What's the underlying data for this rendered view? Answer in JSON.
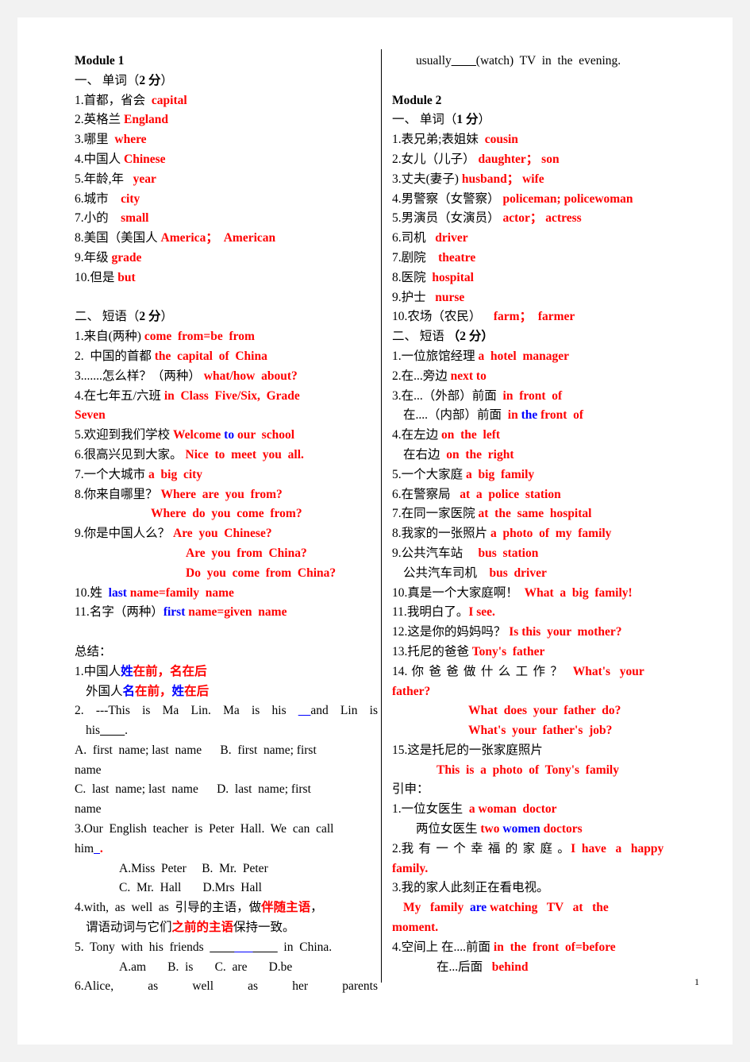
{
  "document": {
    "page_number": "1",
    "colors": {
      "answer_red": "#ff0000",
      "highlight_blue": "#0000ff",
      "body_black": "#000000",
      "page_background": "#ffffff",
      "canvas_background": "#f2f2f2"
    }
  },
  "left_column": {
    "module_title": "Module 1",
    "section_vocab_title_prefix": "一、 单词（",
    "section_vocab_points": "2 分",
    "section_vocab_title_suffix": "）",
    "vocab_items": [
      {
        "num": "1.",
        "cn": "首都，省会",
        "en": "capital"
      },
      {
        "num": "2.",
        "cn": "英格兰",
        "en": "England"
      },
      {
        "num": "3.",
        "cn": "哪里",
        "en": "where"
      },
      {
        "num": "4.",
        "cn": "中国人",
        "en": "Chinese"
      },
      {
        "num": "5.",
        "cn": "年龄,年",
        "en": "year"
      },
      {
        "num": "6.",
        "cn": "城市",
        "en": "city"
      },
      {
        "num": "7.",
        "cn": "小的",
        "en": "small"
      },
      {
        "num": "8.",
        "cn": "美国（美国人",
        "en": "America；  American"
      },
      {
        "num": "9.",
        "cn": "年级",
        "en": "grade"
      },
      {
        "num": "10.",
        "cn": "但是",
        "en": "but"
      }
    ],
    "section_phrase_title_prefix": "二、 短语（",
    "section_phrase_points": "2 分",
    "section_phrase_title_suffix": "）",
    "phrases": {
      "p1_num": "1.",
      "p1_cn": "来自(两种)",
      "p1_en": "come  from=be  from",
      "p2_num": "2.",
      "p2_cn": "  中国的首都",
      "p2_en": "the  capital  of  China",
      "p3_num": "3.",
      "p3_cn": "......怎么样？（两种）",
      "p3_en": "what/how  about?",
      "p4_num": "4.",
      "p4_cn": "在七年五/六班",
      "p4_en": "in  Class  Five/Six,  Grade",
      "p4_en_wrap": "Seven",
      "p5_num": "5.",
      "p5_cn": "欢迎到我们学校",
      "p5_en_a": "Welcome",
      "p5_en_blue": "to",
      "p5_en_b": "our  school",
      "p6_num": "6.",
      "p6_cn": "很高兴见到大家。",
      "p6_en": "Nice  to  meet  you  all.",
      "p7_num": "7.",
      "p7_cn": "一个大城市",
      "p7_en": "a  big  city",
      "p8_num": "8.",
      "p8_cn": "你来自哪里？",
      "p8_en_1": "Where  are  you  from?",
      "p8_en_2": "Where  do  you  come  from?",
      "p9_num": "9.",
      "p9_cn": "你是中国人么？",
      "p9_en_1": "Are  you  Chinese?",
      "p9_en_2": "Are  you  from  China?",
      "p9_en_3": "Do  you  come  from  China?",
      "p10_num": "10.",
      "p10_cn": "姓",
      "p10_en_blue": "last",
      "p10_en_red": "name=family  name",
      "p11_num": "11.",
      "p11_cn": "名字（两种）",
      "p11_en_blue": "first",
      "p11_en_red": "name=given  name"
    },
    "summary_title": "总结：",
    "summary": {
      "s1_num": "1.",
      "s1_black": "中国人",
      "s1_blue": "姓",
      "s1_red": "在前，名在后",
      "s1b_black": "外国人",
      "s1b_blue1": "名",
      "s1b_red1": "在前，",
      "s1b_blue2": "姓",
      "s1b_red2": "在后",
      "q2_text_a": "2.  ---This  is  Ma  Lin.  Ma  is  his  ",
      "q2_blank1": "__",
      "q2_text_b": "and  Lin  is",
      "q2_text_c": "his",
      "q2_blank2": "____",
      "q2_text_d": ".",
      "q2_optA": "A.  first  name; last  name",
      "q2_optB": "B.  first  name; first",
      "q2_optB_wrap": "name",
      "q2_optC": "C.  last  name; last  name",
      "q2_optD": "D.  last  name; first",
      "q2_optD_wrap": "name",
      "q3_text": "3.Our  English  teacher  is  Peter  Hall.  We  can  call",
      "q3_text_b": "him",
      "q3_blank": "_",
      "q3_period": ".",
      "q3_optA": "A.Miss  Peter",
      "q3_optB": "B.  Mr.  Peter",
      "q3_optC": "C.  Mr.  Hall",
      "q3_optD": "D.Mrs  Hall",
      "r4_num": "4.",
      "r4_a": "with,  as  well  as  ",
      "r4_b": "引导的主语，做",
      "r4_red1": "伴随主语",
      "r4_c": "，",
      "r4_d": "谓语动词与它们",
      "r4_red2": "之前的主语",
      "r4_e": "保持一致。",
      "q5_text_a": "5.  Tony  with  his  friends  ",
      "q5_blank_a": "____",
      "q5_blank_blue": "___",
      "q5_blank_b": "____",
      "q5_text_b": "  in  China.",
      "q5_optA": "A.am",
      "q5_optB": "B.  is",
      "q5_optC": "C.  are",
      "q5_optD": "D.be",
      "q6_text": "6.Alice,      as      well      as      her      parents"
    }
  },
  "right_column": {
    "continuation_line_a": "usually",
    "continuation_blank": "____",
    "continuation_line_b": "(watch)  TV  in  the  evening.",
    "module_title": "Module 2",
    "section_vocab_title_prefix": "一、 单词（",
    "section_vocab_points": "1 分",
    "section_vocab_title_suffix": "）",
    "vocab_items": [
      {
        "num": "1.",
        "cn": "表兄弟;表姐妹",
        "en": "cousin"
      },
      {
        "num": "2.",
        "cn": "女儿（儿子）",
        "en": "daughter； son"
      },
      {
        "num": "3.",
        "cn": "丈夫(妻子)",
        "en": "husband； wife"
      },
      {
        "num": "4.",
        "cn": "男警察（女警察）",
        "en": "policeman; policewoman"
      },
      {
        "num": "5.",
        "cn": "男演员（女演员）",
        "en": "actor； actress"
      },
      {
        "num": "6.",
        "cn": "司机",
        "en": "driver"
      },
      {
        "num": "7.",
        "cn": "剧院",
        "en": "theatre"
      },
      {
        "num": "8.",
        "cn": "医院",
        "en": "hospital"
      },
      {
        "num": "9.",
        "cn": "护士",
        "en": "nurse"
      },
      {
        "num": "10.",
        "cn": "农场（农民）",
        "en": "farm；  farmer"
      }
    ],
    "section_phrase_title_prefix": "二、 短语",
    "section_phrase_points": "（2 分）",
    "phrases": {
      "p1_num": "1.",
      "p1_cn": "一位旅馆经理",
      "p1_en": "a  hotel  manager",
      "p2_num": "2.",
      "p2_cn": "在...旁边",
      "p2_en": "next to",
      "p3_num": "3.",
      "p3_cn": "在...（外部）前面",
      "p3_en": "in  front  of",
      "p3b_cn": "在....（内部）前面",
      "p3b_en_a": "in",
      "p3b_en_blue": "the",
      "p3b_en_b": "front  of",
      "p4_num": "4.",
      "p4_cn": "在左边",
      "p4_en": "on  the  left",
      "p4b_cn": "在右边",
      "p4b_en": "on  the  right",
      "p5_num": "5.",
      "p5_cn": "一个大家庭",
      "p5_en": "a  big  family",
      "p6_num": "6.",
      "p6_cn": "在警察局",
      "p6_en": "at  a  police  station",
      "p7_num": "7.",
      "p7_cn": "在同一家医院",
      "p7_en": "at  the  same  hospital",
      "p8_num": "8.",
      "p8_cn": "我家的一张照片",
      "p8_en": "a  photo  of  my  family",
      "p9_num": "9.",
      "p9_cn": "公共汽车站",
      "p9_en": "bus  station",
      "p9b_cn": "公共汽车司机",
      "p9b_en": "bus  driver",
      "p10_num": "10.",
      "p10_cn": "真是一个大家庭啊！",
      "p10_en": "What  a  big  family!",
      "p11_num": "11.",
      "p11_cn": "我明白了。",
      "p11_en": "I see.",
      "p12_num": "12.",
      "p12_cn": "这是你的妈妈吗？",
      "p12_en": "Is this  your  mother?",
      "p13_num": "13.",
      "p13_cn": "托尼的爸爸",
      "p13_en": "Tony's  father",
      "p14_num": "14.",
      "p14_cn": " 你 爸 爸 做 什 么 工 作 ？",
      "p14_en_a": "What's   your",
      "p14_en_wrap": "father?",
      "p14_en_2": "What  does  your  father  do?",
      "p14_en_3": "What's  your  father's  job?",
      "p15_num": "15.",
      "p15_cn": "这是托尼的一张家庭照片",
      "p15_en": "This  is  a  photo  of  Tony's  family"
    },
    "extension_title": "引申：",
    "extension": {
      "e1_num": "1.",
      "e1_cn": "一位女医生",
      "e1_en": "a woman  doctor",
      "e1b_cn": "两位女医生",
      "e1b_en_a": "two",
      "e1b_en_blue": "women",
      "e1b_en_b": "doctors",
      "e2_num": "2.",
      "e2_cn": "我 有 一 个 幸 福 的 家 庭 。",
      "e2_en": "I  have   a   happy",
      "e2_en_wrap": "family.",
      "e3_num": "3.",
      "e3_cn": "我的家人此刻正在看电视。",
      "e3_en_a": "My   family",
      "e3_en_blue": "are",
      "e3_en_b": "watching   TV   at   the",
      "e3_en_wrap": "moment.",
      "e4_num": "4.",
      "e4_cn_a": "空间上",
      "e4_cn_b": "在....前面",
      "e4_en": "in  the  front  of=before",
      "e4b_cn": "在...后面",
      "e4b_en": "behind"
    }
  }
}
